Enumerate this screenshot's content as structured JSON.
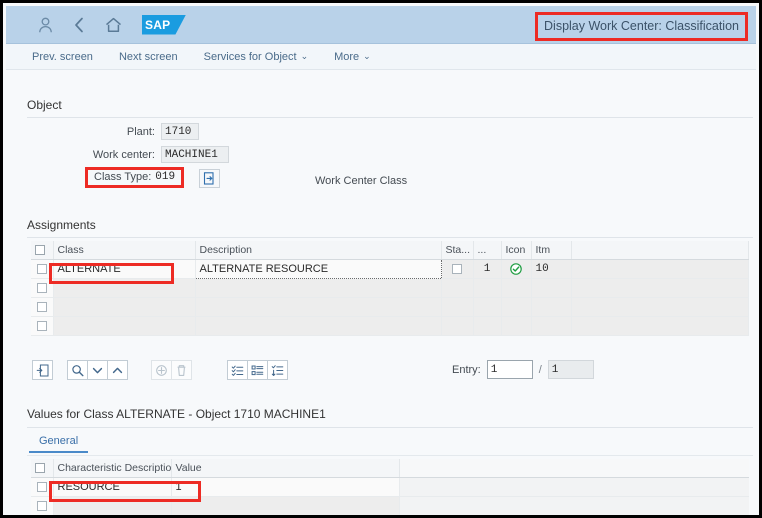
{
  "shell": {
    "title": "Display Work Center: Classification",
    "icons": [
      "user-icon",
      "back-icon",
      "home-icon"
    ],
    "logo_text": "SAP",
    "accent_blue": "#1a9ce0",
    "header_bg": "#b9d2e9",
    "annotation_color": "#ed2b24"
  },
  "action_bar": {
    "items": [
      {
        "label": "Prev. screen",
        "has_caret": false
      },
      {
        "label": "Next screen",
        "has_caret": false
      },
      {
        "label": "Services for Object",
        "has_caret": true
      },
      {
        "label": "More",
        "has_caret": true
      }
    ],
    "caret_glyph": "⌄"
  },
  "object_section": {
    "title": "Object",
    "fields": [
      {
        "label": "Plant:",
        "value": "1710"
      },
      {
        "label": "Work center:",
        "value": "MACHINE1"
      }
    ],
    "class_type": {
      "label": "Class Type:",
      "value": "019",
      "annotated": true
    },
    "display_button_icon": "display-document-icon",
    "side_label": "Work Center Class"
  },
  "assignments_section": {
    "title": "Assignments",
    "columns": [
      {
        "key": "select",
        "label": "",
        "type": "checkbox"
      },
      {
        "key": "class",
        "label": "Class"
      },
      {
        "key": "description",
        "label": "Description"
      },
      {
        "key": "status",
        "label": "Sta..."
      },
      {
        "key": "more",
        "label": "..."
      },
      {
        "key": "icon",
        "label": "Icon"
      },
      {
        "key": "itm",
        "label": "Itm"
      }
    ],
    "rows": [
      {
        "selected": false,
        "class": "ALTERNATE",
        "description": "ALTERNATE RESOURCE",
        "status_checkbox": false,
        "more": "1",
        "icon": "green-check-icon",
        "itm": "10",
        "annotated_class": true,
        "focused_description": true
      },
      {
        "selected": false,
        "class": "",
        "description": "",
        "more": "",
        "itm": ""
      },
      {
        "selected": false,
        "class": "",
        "description": "",
        "more": "",
        "itm": ""
      },
      {
        "selected": false,
        "class": "",
        "description": "",
        "more": "",
        "itm": ""
      }
    ],
    "toolbar": {
      "group_1": [
        {
          "name": "insert-row-icon",
          "enabled": true
        }
      ],
      "group_2": [
        {
          "name": "find-icon",
          "enabled": true
        },
        {
          "name": "chevron-down-icon",
          "enabled": true
        },
        {
          "name": "chevron-up-icon",
          "enabled": true
        }
      ],
      "group_3": [
        {
          "name": "add-circle-icon",
          "enabled": false
        },
        {
          "name": "delete-trash-icon",
          "enabled": false
        }
      ],
      "group_4": [
        {
          "name": "list-check-icon",
          "enabled": true
        },
        {
          "name": "list-detail-icon",
          "enabled": true
        },
        {
          "name": "list-sort-icon",
          "enabled": true
        }
      ]
    },
    "entry": {
      "label": "Entry:",
      "current": "1",
      "separator": "/",
      "total": "1"
    }
  },
  "values_section": {
    "title": "Values for Class ALTERNATE - Object 1710 MACHINE1",
    "tabs": [
      {
        "label": "General",
        "active": true
      }
    ],
    "columns": [
      {
        "key": "select",
        "label": "",
        "type": "checkbox"
      },
      {
        "key": "characteristic",
        "label": "Characteristic Description"
      },
      {
        "key": "value",
        "label": "Value"
      },
      {
        "key": "filler",
        "label": ""
      }
    ],
    "rows": [
      {
        "selected": false,
        "characteristic": "RESOURCE",
        "value": "1",
        "annotated": true
      },
      {
        "selected": false,
        "characteristic": "",
        "value": ""
      }
    ]
  }
}
